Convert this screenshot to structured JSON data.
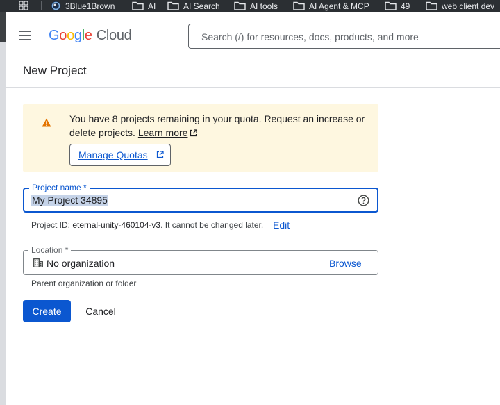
{
  "bookmarks": [
    {
      "label": "3Blue1Brown",
      "icon": "3b1b-icon"
    },
    {
      "label": "AI",
      "icon": "folder-icon"
    },
    {
      "label": "AI Search",
      "icon": "folder-icon"
    },
    {
      "label": "AI tools",
      "icon": "folder-icon"
    },
    {
      "label": "AI Agent & MCP",
      "icon": "folder-icon"
    },
    {
      "label": "49",
      "icon": "folder-icon"
    },
    {
      "label": "web client dev",
      "icon": "folder-icon"
    }
  ],
  "header": {
    "logo": {
      "g1": "G",
      "g2": "o",
      "g3": "o",
      "g4": "g",
      "g5": "l",
      "g6": "e",
      "product": "Cloud"
    },
    "search_placeholder": "Search (/) for resources, docs, products, and more"
  },
  "page": {
    "title": "New Project"
  },
  "quota": {
    "message": "You have 8 projects remaining in your quota. Request an increase or delete projects.",
    "learn_more": "Learn more",
    "manage_button": "Manage Quotas"
  },
  "form": {
    "project_name_label": "Project name *",
    "project_name_value": "My Project 34895",
    "project_id_prefix": "Project ID: ",
    "project_id_value": "eternal-unity-460104-v3",
    "project_id_suffix": ". It cannot be changed later.",
    "edit_label": "Edit",
    "location_label": "Location *",
    "location_value": "No organization",
    "browse_label": "Browse",
    "location_hint": "Parent organization or folder",
    "create_label": "Create",
    "cancel_label": "Cancel"
  },
  "colors": {
    "accent": "#0b57d0",
    "banner": "#fef7e0",
    "warning": "#e37400"
  }
}
